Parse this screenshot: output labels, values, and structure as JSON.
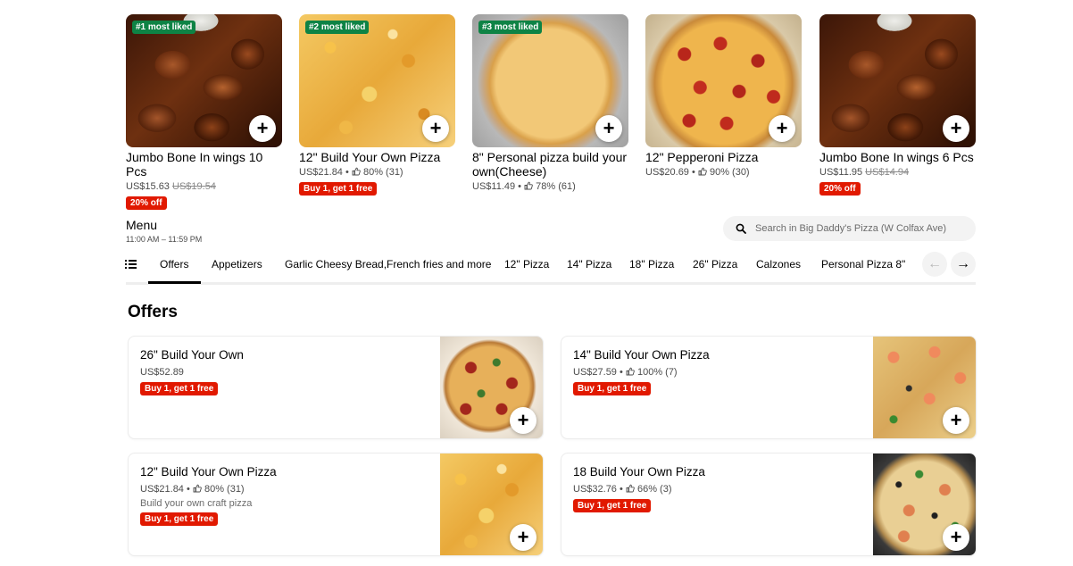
{
  "featured": [
    {
      "title": "Jumbo Bone In wings 10 Pcs",
      "badge": "#1 most liked",
      "price": "US$15.63",
      "old_price": "US$19.54",
      "rating": "",
      "promo": "20% off",
      "image": "wings"
    },
    {
      "title": "12\" Build Your Own Pizza",
      "badge": "#2 most liked",
      "price": "US$21.84",
      "old_price": "",
      "rating": "80% (31)",
      "promo": "Buy 1, get 1 free",
      "image": "cheese"
    },
    {
      "title": "8\" Personal pizza build your own(Cheese)",
      "badge": "#3 most liked",
      "price": "US$11.49",
      "old_price": "",
      "rating": "78% (61)",
      "promo": "",
      "image": "personal"
    },
    {
      "title": "12\" Pepperoni Pizza",
      "badge": "",
      "price": "US$20.69",
      "old_price": "",
      "rating": "90% (30)",
      "promo": "",
      "image": "pepperoni"
    },
    {
      "title": "Jumbo Bone In wings 6 Pcs",
      "badge": "",
      "price": "US$11.95",
      "old_price": "US$14.94",
      "rating": "",
      "promo": "20% off",
      "image": "wings"
    }
  ],
  "menu": {
    "title": "Menu",
    "hours": "11:00 AM – 11:59 PM",
    "search_placeholder": "Search in Big Daddy's Pizza (W Colfax Ave)"
  },
  "tabs": [
    {
      "label": "Offers",
      "active": true
    },
    {
      "label": "Appetizers",
      "active": false
    },
    {
      "label": "Garlic Cheesy Bread,French fries and more",
      "active": false
    },
    {
      "label": "12\" Pizza",
      "active": false
    },
    {
      "label": "14\" Pizza",
      "active": false
    },
    {
      "label": "18\" Pizza",
      "active": false
    },
    {
      "label": "26\" Pizza",
      "active": false
    },
    {
      "label": "Calzones",
      "active": false
    },
    {
      "label": "Personal Pizza 8\"",
      "active": false
    }
  ],
  "nav_arrows": {
    "prev": "←",
    "next": "→"
  },
  "offers": {
    "heading": "Offers",
    "items": [
      {
        "title": "26\" Build Your Own",
        "price": "US$52.89",
        "rating": "",
        "description": "",
        "promo": "Buy 1, get 1 free",
        "image": "big-pepp"
      },
      {
        "title": "14\" Build Your Own Pizza",
        "price": "US$27.59",
        "rating": "100% (7)",
        "description": "",
        "promo": "Buy 1, get 1 free",
        "image": "shrimp"
      },
      {
        "title": "12\" Build Your Own Pizza",
        "price": "US$21.84",
        "rating": "80% (31)",
        "description": "Build your own craft pizza",
        "promo": "Buy 1, get 1 free",
        "image": "cheese"
      },
      {
        "title": "18 Build Your Own Pizza",
        "price": "US$32.76",
        "rating": "66% (3)",
        "description": "",
        "promo": "Buy 1, get 1 free",
        "image": "supreme"
      }
    ]
  },
  "icons": {
    "add": "plus-icon",
    "search": "search-icon",
    "list": "list-icon",
    "rating": "thumbs-up-icon"
  },
  "colors": {
    "promo_red": "#e11900",
    "liked_green": "#0e8345",
    "text_gray": "#4b4b4b"
  }
}
